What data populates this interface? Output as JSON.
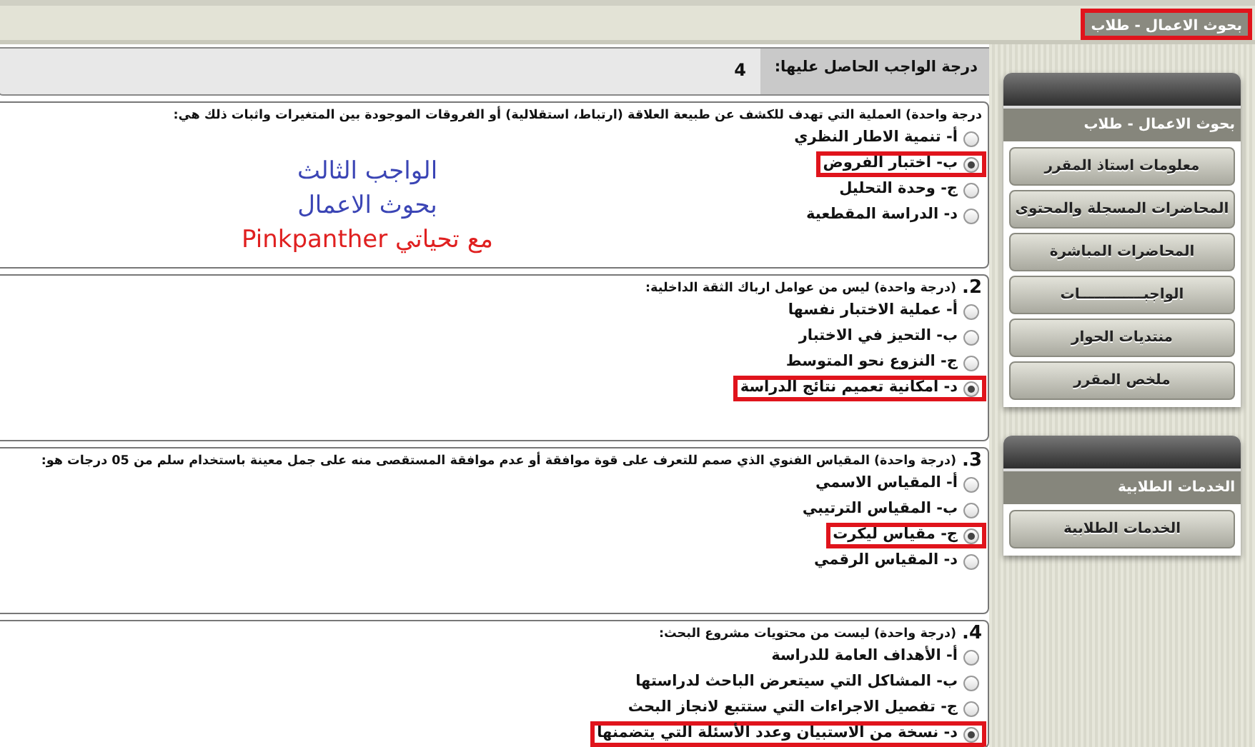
{
  "breadcrumb": {
    "text": "بحوث الاعمال - طلاب",
    "highlighted": true
  },
  "score": {
    "label": "درجة الواجب الحاصل عليها:",
    "value": "4"
  },
  "questions": [
    {
      "text": "درجة واحدة) العملية التي تهدف للكشف عن طبيعة العلاقة (ارتباط، استقلالية) أو الفروقات الموجودة بين المتغيرات واثبات ذلك هي:",
      "options": [
        {
          "label": "أ- تنمية الاطار النظري",
          "selected": false,
          "highlighted": false
        },
        {
          "label": "ب- اختبار الفروض",
          "selected": true,
          "highlighted": true
        },
        {
          "label": "ج- وحدة التحليل",
          "selected": false,
          "highlighted": false
        },
        {
          "label": "د- الدراسة المقطعية",
          "selected": false,
          "highlighted": false
        }
      ],
      "notes": [
        {
          "text": "الواجب الثالث",
          "color": "#3b45b5"
        },
        {
          "text": "بحوث الاعمال",
          "color": "#3b45b5"
        },
        {
          "text": "مع تحياتي Pinkpanther",
          "color": "#e02020"
        }
      ]
    },
    {
      "number": "2.",
      "text": "(درجة واحدة) ليس من عوامل ارباك الثقة الداخلية:",
      "options": [
        {
          "label": "أ- عملية الاختبار نفسها",
          "selected": false,
          "highlighted": false
        },
        {
          "label": "ب- التحيز في الاختبار",
          "selected": false,
          "highlighted": false
        },
        {
          "label": "ج- النزوع نحو المتوسط",
          "selected": false,
          "highlighted": false
        },
        {
          "label": "د- امكانية تعميم نتائج الدراسة",
          "selected": true,
          "highlighted": true
        }
      ]
    },
    {
      "number": "3.",
      "text": "(درجة واحدة) المقياس الفنوي الذي صمم للتعرف على قوة موافقة أو عدم موافقة المستقصى منه على جمل معينة باستخدام سلم من 05 درجات هو:",
      "options": [
        {
          "label": "أ- المقياس الاسمي",
          "selected": false,
          "highlighted": false
        },
        {
          "label": "ب- المقياس الترتيبي",
          "selected": false,
          "highlighted": false
        },
        {
          "label": "ج- مقياس ليكرت",
          "selected": true,
          "highlighted": true
        },
        {
          "label": "د- المقياس الرقمي",
          "selected": false,
          "highlighted": false
        }
      ]
    },
    {
      "number": "4.",
      "text": "(درجة واحدة) ليست من محتويات مشروع البحث:",
      "options": [
        {
          "label": "أ- الأهداف العامة للدراسة",
          "selected": false,
          "highlighted": false
        },
        {
          "label": "ب- المشاكل التي سيتعرض الباحث لدراستها",
          "selected": false,
          "highlighted": false
        },
        {
          "label": "ج- تفصيل الاجراءات التي ستتبع لانجاز البحث",
          "selected": false,
          "highlighted": false
        },
        {
          "label": "د- نسخة من الاستبيان وعدد الأسئلة التي يتضمنها",
          "selected": true,
          "highlighted": true
        }
      ]
    }
  ],
  "sidebar": [
    {
      "title": "بحوث الاعمال - طلاب",
      "items": [
        "معلومات استاذ المقرر",
        "المحاضرات المسجلة والمحتوى",
        "المحاضرات المباشرة",
        "الواجبـــــــــــــات",
        "منتديات الحوار",
        "ملخص المقرر"
      ]
    },
    {
      "title": "الخدمات الطلابية",
      "items": [
        "الخدمات الطلابية"
      ]
    }
  ]
}
